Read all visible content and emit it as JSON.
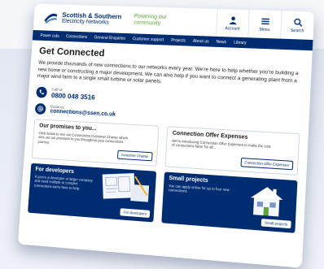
{
  "header": {
    "brand_line1": "Scottish & Southern",
    "brand_line2": "Electricity Networks",
    "tagline_line1": "Powering our",
    "tagline_line2": "community",
    "buttons": [
      {
        "label": "Account",
        "icon": "person-icon"
      },
      {
        "label": "Menu",
        "icon": "menu-icon"
      },
      {
        "label": "Search",
        "icon": "search-icon"
      }
    ]
  },
  "nav": {
    "items": [
      "Power cuts",
      "Connections",
      "General Enquiries",
      "Customer support",
      "Projects",
      "About us",
      "News",
      "Library"
    ]
  },
  "main": {
    "title": "Get Connected",
    "intro": "We provide thousands of new connections to our networks every year. We're here to help whether you're building a new home or constructing a major development. We can also help if you want to connect a generating plant from a major wind farm to a single small turbine or solar panels.",
    "call_label": "Call us",
    "phone": "0800 048 3516",
    "email_label": "Email us",
    "email": "connections@ssen.co.uk"
  },
  "cards": [
    {
      "title": "Our promises to you...",
      "text": "Click below to see our Connections Customer Charter which sets out our promises to you throughout your connections journey.",
      "button": "Customer Charter"
    },
    {
      "title": "Connection Offer Expenses",
      "text": "We're introducing Connection Offer Expenses to make the cost of connections fairer for all...",
      "button": "Connection Offer Expenses"
    }
  ],
  "blue_cards": [
    {
      "title": "For developers",
      "text": "If you're a developer or larger company and need multiple or complex connections we're here to help.",
      "button": "For developers"
    },
    {
      "title": "Small projects",
      "text": "You can apply online for up to four new connections.",
      "button": "Small projects"
    }
  ],
  "colors": {
    "brand_navy": "#002d72",
    "brand_green": "#5ea63b"
  }
}
